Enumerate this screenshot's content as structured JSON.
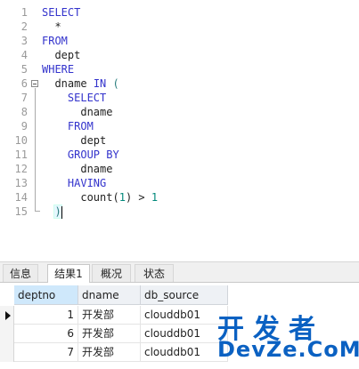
{
  "editor": {
    "lines": [
      {
        "n": "1",
        "indent": "",
        "parts": [
          {
            "t": "SELECT",
            "c": "kw"
          }
        ]
      },
      {
        "n": "2",
        "indent": "  ",
        "parts": [
          {
            "t": "*",
            "c": ""
          }
        ]
      },
      {
        "n": "3",
        "indent": "",
        "parts": [
          {
            "t": "FROM",
            "c": "kw"
          }
        ]
      },
      {
        "n": "4",
        "indent": "  ",
        "parts": [
          {
            "t": "dept",
            "c": ""
          }
        ]
      },
      {
        "n": "5",
        "indent": "",
        "parts": [
          {
            "t": "WHERE",
            "c": "kw"
          }
        ]
      },
      {
        "n": "6",
        "indent": "  ",
        "parts": [
          {
            "t": "dname ",
            "c": ""
          },
          {
            "t": "IN",
            "c": "kw"
          },
          {
            "t": " ",
            "c": ""
          },
          {
            "t": "(",
            "c": "paren"
          }
        ],
        "fold": true
      },
      {
        "n": "7",
        "indent": "    ",
        "parts": [
          {
            "t": "SELECT",
            "c": "kw"
          }
        ]
      },
      {
        "n": "8",
        "indent": "      ",
        "parts": [
          {
            "t": "dname",
            "c": ""
          }
        ]
      },
      {
        "n": "9",
        "indent": "    ",
        "parts": [
          {
            "t": "FROM",
            "c": "kw"
          }
        ]
      },
      {
        "n": "10",
        "indent": "      ",
        "parts": [
          {
            "t": "dept",
            "c": ""
          }
        ]
      },
      {
        "n": "11",
        "indent": "    ",
        "parts": [
          {
            "t": "GROUP BY",
            "c": "kw"
          }
        ]
      },
      {
        "n": "12",
        "indent": "      ",
        "parts": [
          {
            "t": "dname",
            "c": ""
          }
        ]
      },
      {
        "n": "13",
        "indent": "    ",
        "parts": [
          {
            "t": "HAVING",
            "c": "kw"
          }
        ]
      },
      {
        "n": "14",
        "indent": "      ",
        "parts": [
          {
            "t": "count",
            "c": ""
          },
          {
            "t": "(",
            "c": ""
          },
          {
            "t": "1",
            "c": "num"
          },
          {
            "t": ") > ",
            "c": ""
          },
          {
            "t": "1",
            "c": "num"
          }
        ]
      },
      {
        "n": "15",
        "indent": "  ",
        "parts": [
          {
            "t": ")",
            "c": "paren"
          }
        ],
        "cursor": true
      }
    ]
  },
  "tabs": [
    {
      "label": "信息"
    },
    {
      "label": "结果1",
      "active": true
    },
    {
      "label": "概况"
    },
    {
      "label": "状态"
    }
  ],
  "grid": {
    "columns": [
      "deptno",
      "dname",
      "db_source"
    ],
    "rows": [
      [
        "1",
        "开发部",
        "clouddb01"
      ],
      [
        "6",
        "开发部",
        "clouddb01"
      ],
      [
        "7",
        "开发部",
        "clouddb01"
      ]
    ]
  },
  "watermark": {
    "top": "开发者",
    "bottom": "DevZe.CoM"
  },
  "colors": {
    "keyword": "#3333cc",
    "number": "#00897b",
    "watermark": "#0b61c2"
  }
}
